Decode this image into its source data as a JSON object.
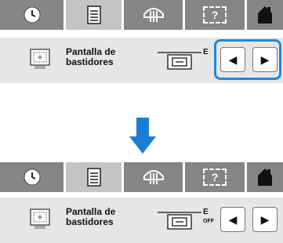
{
  "tabs": [
    {
      "icon": "clock-icon"
    },
    {
      "icon": "document-icon"
    },
    {
      "icon": "thread-icon"
    },
    {
      "icon": "help-icon",
      "label": "?"
    },
    {
      "icon": "home-icon"
    }
  ],
  "panels": [
    {
      "setting_label": "Pantalla de\nbastidores",
      "value_letter": "E",
      "value_sub": "",
      "highlighted": true
    },
    {
      "setting_label": "Pantalla de\nbastidores",
      "value_letter": "E",
      "value_sub": "OFF",
      "highlighted": false
    }
  ],
  "buttons": {
    "prev_symbol": "◀",
    "next_symbol": "▶"
  },
  "colors": {
    "highlight": "#1a8ae0",
    "arrow": "#1a7fd4",
    "tabbar": "#858585",
    "active_tab": "#c4c4c4",
    "row": "#e6e6e6"
  }
}
